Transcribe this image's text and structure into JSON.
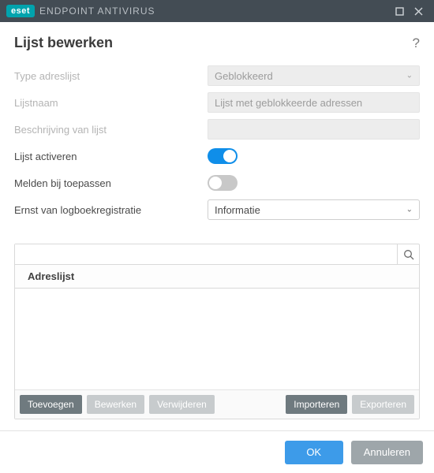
{
  "titlebar": {
    "brand_badge": "eset",
    "brand_text": "ENDPOINT ANTIVIRUS"
  },
  "heading": "Lijst bewerken",
  "form": {
    "type_label": "Type adreslijst",
    "type_value": "Geblokkeerd",
    "name_label": "Lijstnaam",
    "name_value": "Lijst met geblokkeerde adressen",
    "desc_label": "Beschrijving van lijst",
    "desc_value": "",
    "activate_label": "Lijst activeren",
    "activate_on": true,
    "notify_label": "Melden bij toepassen",
    "notify_on": false,
    "severity_label": "Ernst van logboekregistratie",
    "severity_value": "Informatie"
  },
  "list": {
    "search_placeholder": "",
    "column_header": "Adreslijst",
    "buttons": {
      "add": "Toevoegen",
      "edit": "Bewerken",
      "delete": "Verwijderen",
      "import": "Importeren",
      "export": "Exporteren"
    }
  },
  "footer": {
    "ok": "OK",
    "cancel": "Annuleren"
  }
}
